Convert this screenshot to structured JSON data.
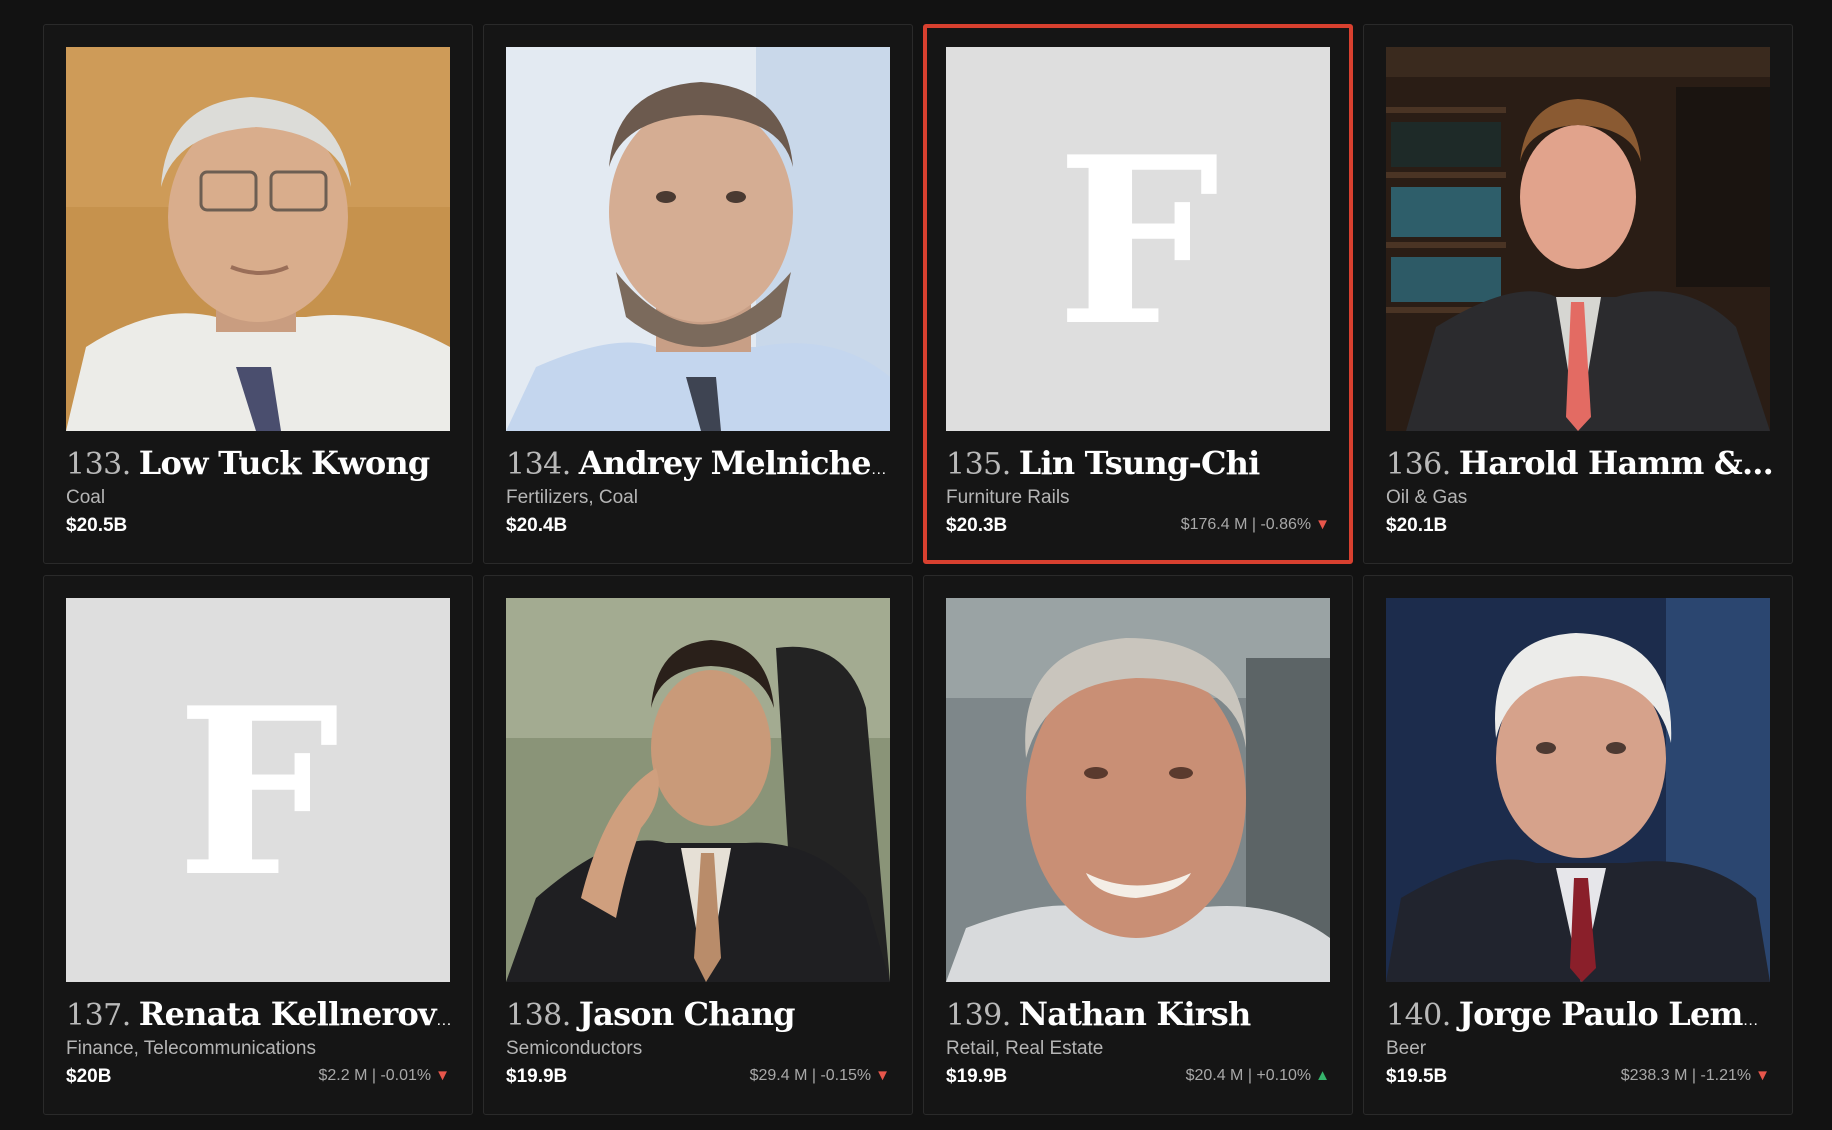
{
  "cards": [
    {
      "rank": "133.",
      "name": "Low Tuck Kwong",
      "industry": "Coal",
      "worth": "$20.5B",
      "change": "",
      "direction": ""
    },
    {
      "rank": "134.",
      "name": "Andrey Melnichen...",
      "industry": "Fertilizers, Coal",
      "worth": "$20.4B",
      "change": "",
      "direction": ""
    },
    {
      "rank": "135.",
      "name": "Lin Tsung-Chi",
      "industry": "Furniture Rails",
      "worth": "$20.3B",
      "change": "$176.4 M | -0.86%",
      "direction": "down",
      "placeholder_letter": "F"
    },
    {
      "rank": "136.",
      "name": "Harold Hamm &...",
      "industry": "Oil & Gas",
      "worth": "$20.1B",
      "change": "",
      "direction": ""
    },
    {
      "rank": "137.",
      "name": "Renata Kellnerova ...",
      "industry": "Finance, Telecommunications",
      "worth": "$20B",
      "change": "$2.2 M | -0.01%",
      "direction": "down",
      "placeholder_letter": "F"
    },
    {
      "rank": "138.",
      "name": "Jason Chang",
      "industry": "Semiconductors",
      "worth": "$19.9B",
      "change": "$29.4 M | -0.15%",
      "direction": "down"
    },
    {
      "rank": "139.",
      "name": "Nathan Kirsh",
      "industry": "Retail, Real Estate",
      "worth": "$19.9B",
      "change": "$20.4 M | +0.10%",
      "direction": "up"
    },
    {
      "rank": "140.",
      "name": "Jorge Paulo Leman...",
      "industry": "Beer",
      "worth": "$19.5B",
      "change": "$238.3 M | -1.21%",
      "direction": "down"
    }
  ],
  "arrows": {
    "down": "▼",
    "up": "▲"
  },
  "colors": {
    "selected_border": "#d8402f",
    "down": "#e8564b",
    "up": "#35b36b",
    "placeholder_bg": "#dedede"
  }
}
